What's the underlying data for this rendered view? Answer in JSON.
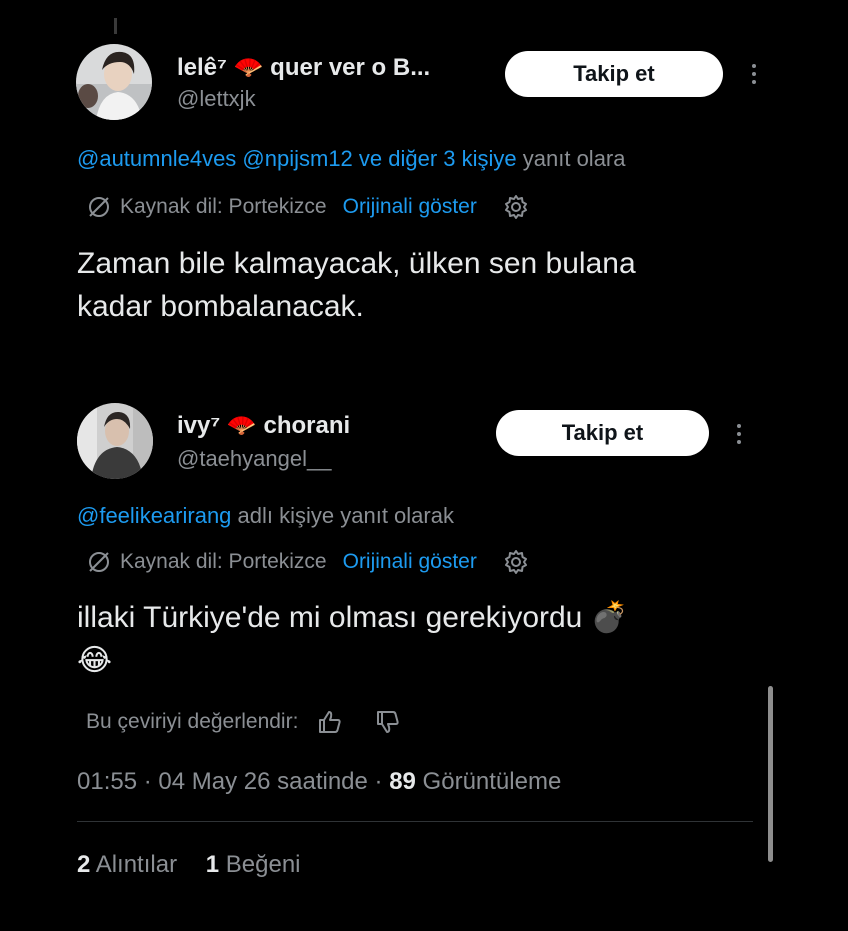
{
  "tweet1": {
    "display_name": "lelê⁷ 🪭 quer ver o B...",
    "handle": "@lettxjk",
    "follow_label": "Takip et",
    "reply_mentions": "@autumnle4ves @npijsm12 ve diğer 3 kişiye",
    "reply_suffix": " yanıt olara",
    "source_lang": "Kaynak dil: Portekizce",
    "show_original": "Orijinali göster",
    "text_line1": "Zaman bile kalmayacak, ülken sen bulana",
    "text_line2": "kadar bombalanacak."
  },
  "tweet2": {
    "display_name": "ivy⁷ 🪭 chorani",
    "handle": "@taehyangel__",
    "follow_label": "Takip et",
    "reply_mentions": "@feelikearirang",
    "reply_suffix": " adlı kişiye yanıt olarak",
    "source_lang": "Kaynak dil: Portekizce",
    "show_original": "Orijinali göster",
    "text_line1": "illaki Türkiye'de mi olması gerekiyordu 💣",
    "text_line2": "😂",
    "rate_label": "Bu çeviriyi değerlendir:",
    "timestamp": "01:55 · 04 May 26 saatinde · ",
    "views_count": "89",
    "views_label": " Görüntüleme",
    "quotes_count": "2",
    "quotes_label": " Alıntılar",
    "likes_count": "1",
    "likes_label": " Beğeni"
  },
  "colors": {
    "background": "#000000",
    "link": "#1d9bf0",
    "secondary": "#8b8f94",
    "primary_text": "#e7e9ea"
  }
}
